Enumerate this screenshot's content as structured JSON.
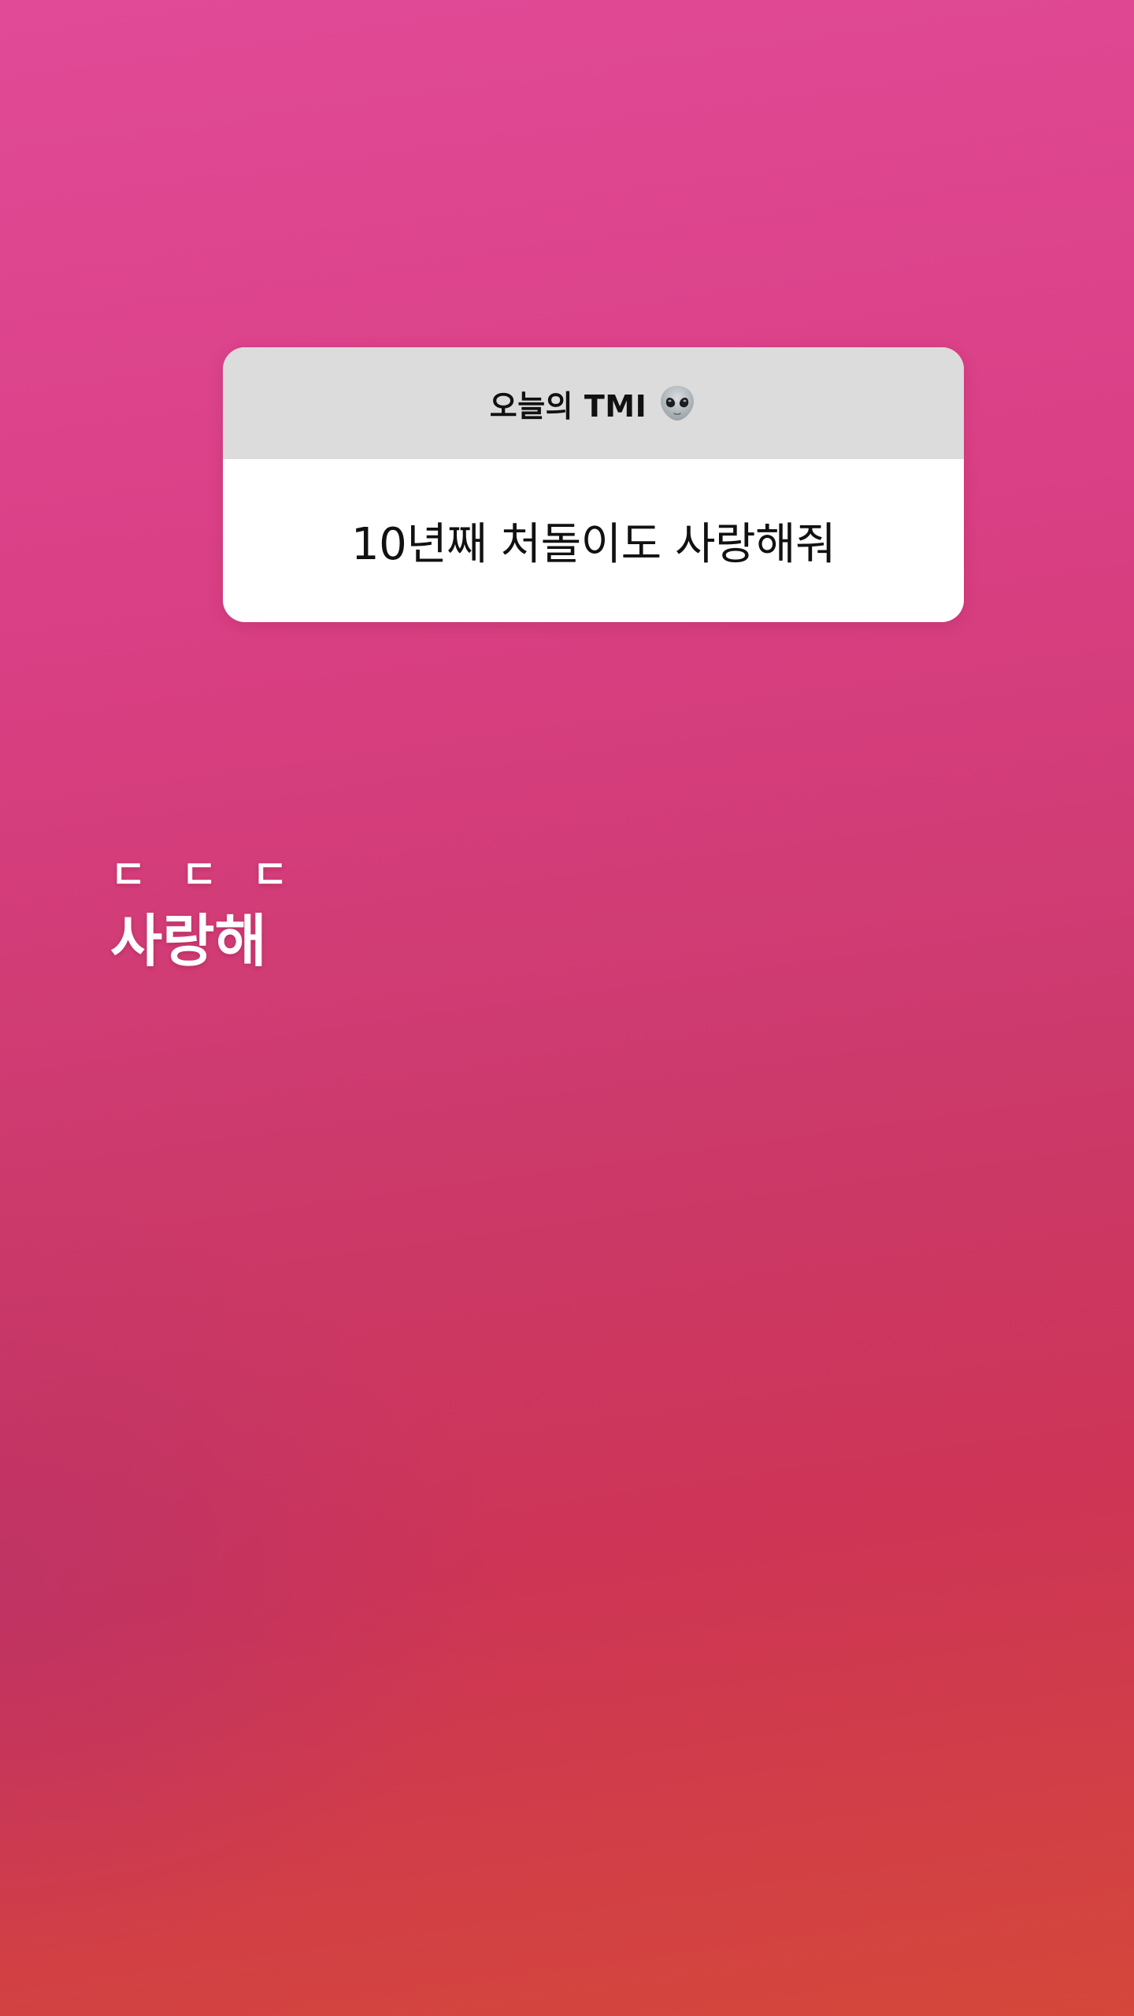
{
  "story": {
    "background_colors": [
      "#e14a97",
      "#d93f84",
      "#cc3a6c",
      "#cd3456",
      "#d5473a"
    ]
  },
  "question_sticker": {
    "title": "오늘의 TMI",
    "title_icon": "alien-icon",
    "answer": "10년째 처돌이도 사랑해줘",
    "header_color": "#dcdcdc",
    "body_color": "#ffffff"
  },
  "caption": {
    "line1": "ㄷㄷㄷ",
    "line2": "사랑해",
    "color": "#ffffff"
  }
}
